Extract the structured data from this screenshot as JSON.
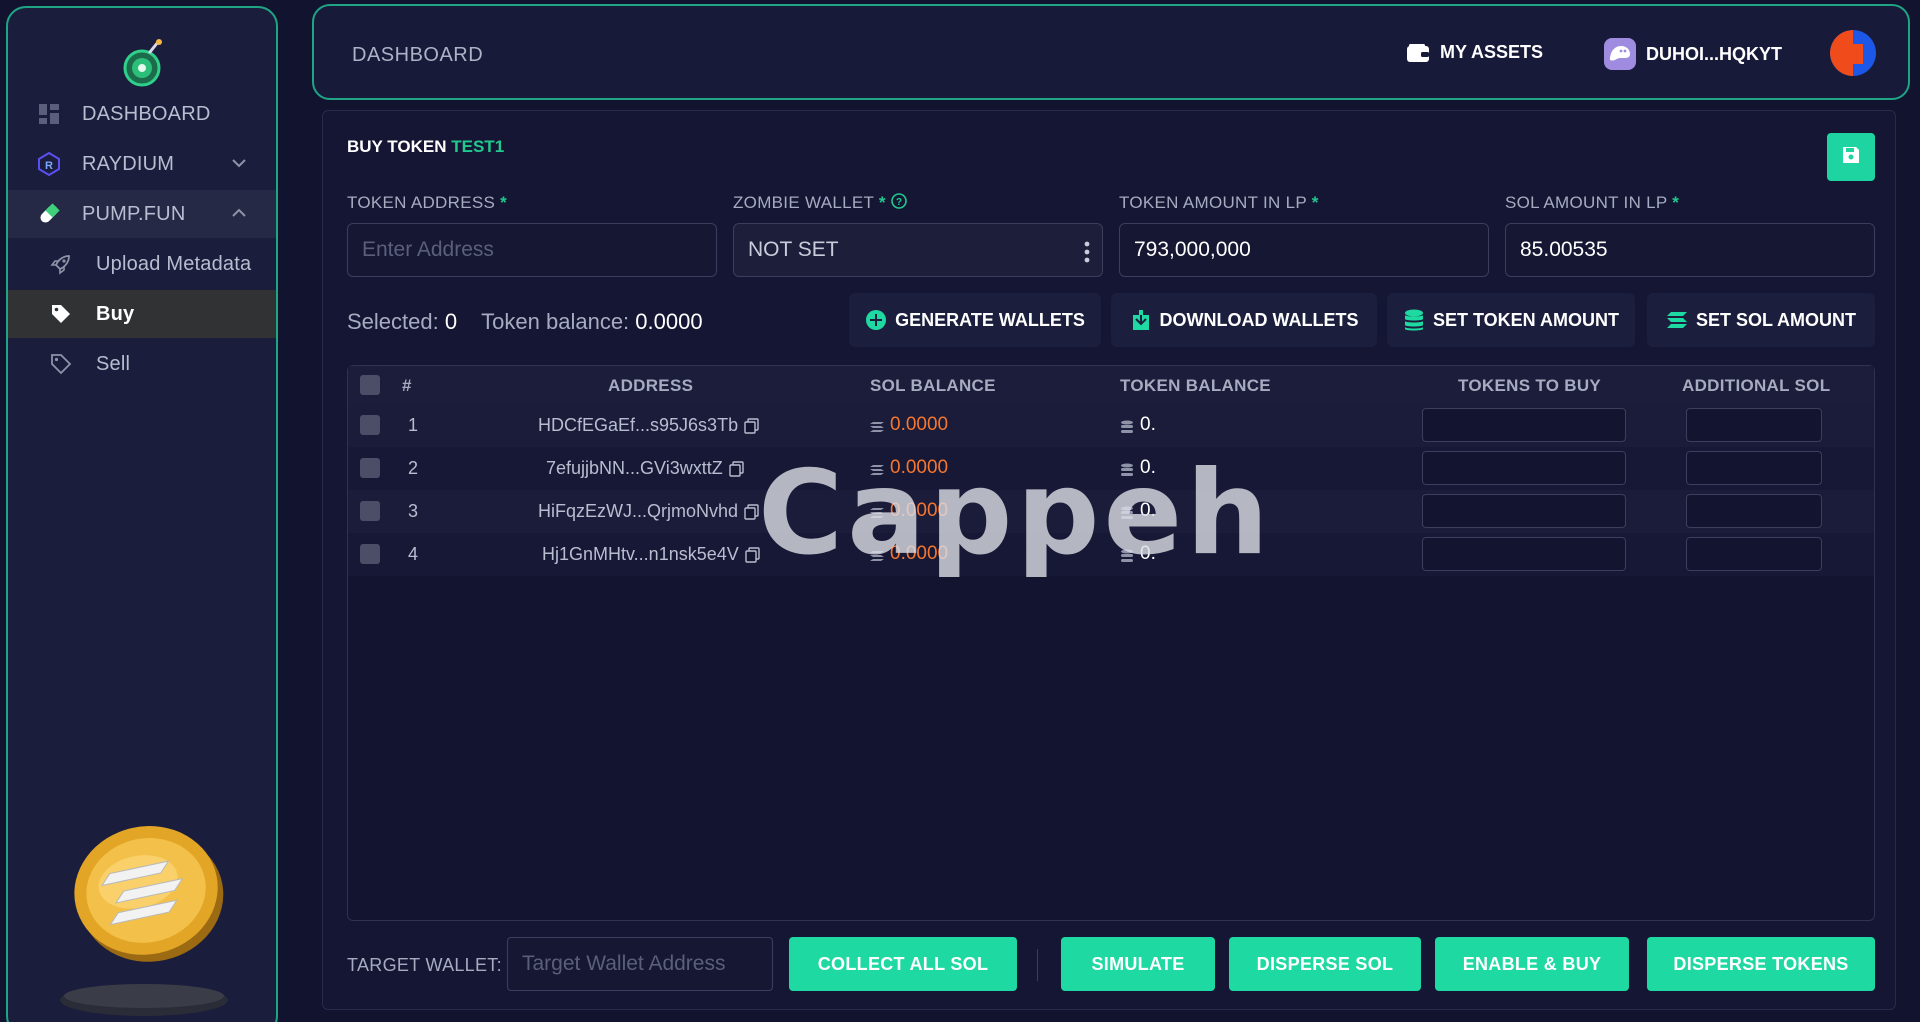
{
  "sidebar": {
    "items": [
      {
        "label": "DASHBOARD",
        "icon": "grid-icon"
      },
      {
        "label": "RAYDIUM",
        "icon": "raydium-icon"
      },
      {
        "label": "PUMP.FUN",
        "icon": "pill-icon"
      },
      {
        "label": "Upload Metadata",
        "icon": "rocket-icon"
      },
      {
        "label": "Buy",
        "icon": "tag-icon"
      },
      {
        "label": "Sell",
        "icon": "tag-outline-icon"
      }
    ]
  },
  "header": {
    "title": "DASHBOARD",
    "assets_label": "MY ASSETS",
    "wallet_label": "DUHOI...HQKYT"
  },
  "panel": {
    "title_prefix": "BUY TOKEN",
    "token_name": "TEST1",
    "fields": {
      "token_address": {
        "label": "TOKEN ADDRESS",
        "placeholder": "Enter Address",
        "value": ""
      },
      "zombie_wallet": {
        "label": "ZOMBIE WALLET",
        "value": "NOT SET"
      },
      "token_amount": {
        "label": "TOKEN AMOUNT IN LP",
        "value": "793,000,000"
      },
      "sol_amount": {
        "label": "SOL AMOUNT IN LP",
        "value": "85.00535"
      }
    },
    "selected_label": "Selected:",
    "selected_value": "0",
    "token_balance_label": "Token balance:",
    "token_balance_value": "0.0000",
    "buttons": {
      "generate": "GENERATE WALLETS",
      "download": "DOWNLOAD WALLETS",
      "set_token": "SET TOKEN AMOUNT",
      "set_sol": "SET SOL AMOUNT"
    },
    "table": {
      "headers": [
        "#",
        "ADDRESS",
        "SOL BALANCE",
        "TOKEN BALANCE",
        "TOKENS TO BUY",
        "ADDITIONAL SOL"
      ],
      "rows": [
        {
          "num": "1",
          "address": "HDCfEGaEf...s95J6s3Tb",
          "sol": "0.0000",
          "token": "0."
        },
        {
          "num": "2",
          "address": "7efujjbNN...GVi3wxttZ",
          "sol": "0.0000",
          "token": "0."
        },
        {
          "num": "3",
          "address": "HiFqzEzWJ...QrjmoNvhd",
          "sol": "0.0000",
          "token": "0."
        },
        {
          "num": "4",
          "address": "Hj1GnMHtv...n1nsk5e4V",
          "sol": "0.0000",
          "token": "0."
        }
      ]
    },
    "bottom": {
      "target_label": "TARGET WALLET:",
      "target_placeholder": "Target Wallet Address",
      "collect": "COLLECT ALL SOL",
      "simulate": "SIMULATE",
      "disperse_sol": "DISPERSE SOL",
      "enable_buy": "ENABLE & BUY",
      "disperse_tokens": "DISPERSE TOKENS"
    }
  },
  "watermark": "Cappeh",
  "colors": {
    "accent": "#1ed9a1",
    "border": "#1fa583",
    "orange": "#f5762f",
    "bg": "#11132f"
  }
}
